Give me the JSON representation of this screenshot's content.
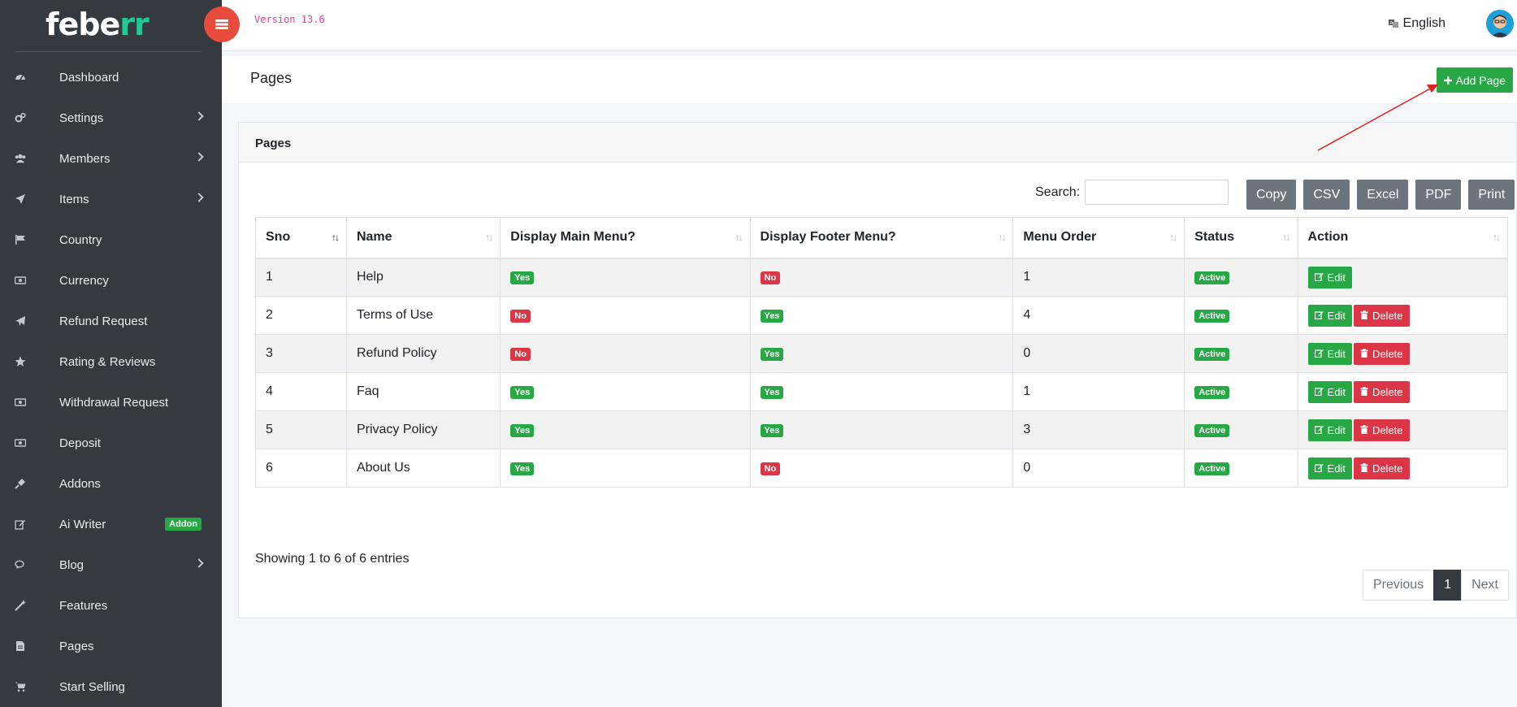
{
  "brand": {
    "logo_main": "febe",
    "logo_accent": "rr"
  },
  "topbar": {
    "version": "Version 13.6",
    "language": "English"
  },
  "sidebar": {
    "items": [
      {
        "label": "Dashboard",
        "icon": "dashboard-icon",
        "chevron": false
      },
      {
        "label": "Settings",
        "icon": "gears-icon",
        "chevron": true
      },
      {
        "label": "Members",
        "icon": "users-icon",
        "chevron": true
      },
      {
        "label": "Items",
        "icon": "location-arrow-icon",
        "chevron": true
      },
      {
        "label": "Country",
        "icon": "flag-icon",
        "chevron": false
      },
      {
        "label": "Currency",
        "icon": "money-icon",
        "chevron": false
      },
      {
        "label": "Refund Request",
        "icon": "paper-plane-icon",
        "chevron": false
      },
      {
        "label": "Rating & Reviews",
        "icon": "star-icon",
        "chevron": false
      },
      {
        "label": "Withdrawal Request",
        "icon": "money-icon",
        "chevron": false
      },
      {
        "label": "Deposit",
        "icon": "money-icon",
        "chevron": false
      },
      {
        "label": "Addons",
        "icon": "plug-icon",
        "chevron": false
      },
      {
        "label": "Ai Writer",
        "icon": "edit-icon",
        "chevron": false,
        "badge": "Addon"
      },
      {
        "label": "Blog",
        "icon": "comments-icon",
        "chevron": true
      },
      {
        "label": "Features",
        "icon": "magic-icon",
        "chevron": false
      },
      {
        "label": "Pages",
        "icon": "file-icon",
        "chevron": false
      },
      {
        "label": "Start Selling",
        "icon": "cart-icon",
        "chevron": false
      }
    ]
  },
  "header": {
    "title": "Pages",
    "add_label": "Add Page"
  },
  "card": {
    "title": "Pages",
    "search_label": "Search:",
    "search_value": "",
    "exports": [
      "Copy",
      "CSV",
      "Excel",
      "PDF",
      "Print"
    ],
    "columns": [
      "Sno",
      "Name",
      "Display Main Menu?",
      "Display Footer Menu?",
      "Menu Order",
      "Status",
      "Action"
    ],
    "rows": [
      {
        "sno": "1",
        "name": "Help",
        "main": "Yes",
        "footer": "No",
        "order": "1",
        "status": "Active",
        "delete": false
      },
      {
        "sno": "2",
        "name": "Terms of Use",
        "main": "No",
        "footer": "Yes",
        "order": "4",
        "status": "Active",
        "delete": true
      },
      {
        "sno": "3",
        "name": "Refund Policy",
        "main": "No",
        "footer": "Yes",
        "order": "0",
        "status": "Active",
        "delete": true
      },
      {
        "sno": "4",
        "name": "Faq",
        "main": "Yes",
        "footer": "Yes",
        "order": "1",
        "status": "Active",
        "delete": true
      },
      {
        "sno": "5",
        "name": "Privacy Policy",
        "main": "Yes",
        "footer": "Yes",
        "order": "3",
        "status": "Active",
        "delete": true
      },
      {
        "sno": "6",
        "name": "About Us",
        "main": "Yes",
        "footer": "No",
        "order": "0",
        "status": "Active",
        "delete": true
      }
    ],
    "edit_label": "Edit",
    "delete_label": "Delete",
    "info": "Showing 1 to 6 of 6 entries",
    "pager": {
      "prev": "Previous",
      "current": "1",
      "next": "Next"
    }
  },
  "colors": {
    "sidebar": "#343a40",
    "accent": "#20c997",
    "success": "#28a745",
    "danger": "#dc3545",
    "secondary": "#6c757d",
    "toggle": "#e74c3c",
    "version": "#e83e8c",
    "arrow": "#e02020"
  }
}
